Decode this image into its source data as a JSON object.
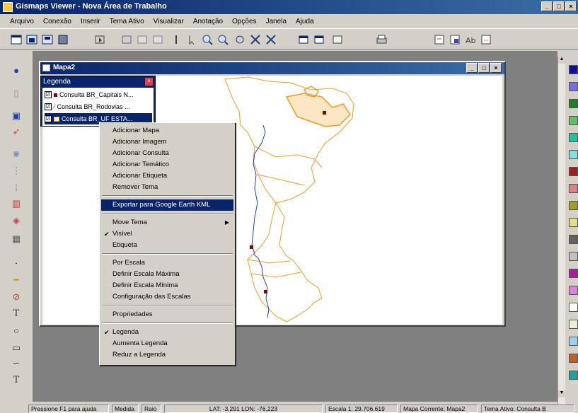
{
  "app": {
    "title": "Gismaps Viewer - Nova Área de Trabalho",
    "window_buttons": [
      "_",
      "□",
      "×"
    ]
  },
  "menu": [
    "Arquivo",
    "Conexão",
    "Inserir",
    "Tema Ativo",
    "Visualizar",
    "Anotação",
    "Opções",
    "Janela",
    "Ajuda"
  ],
  "toolbar": {
    "icons": [
      "new-map-icon",
      "open-icon",
      "save-icon",
      "view-icon",
      "select-icon",
      "info-icon",
      "pan-icon",
      "zoom-in-icon",
      "zoom-out-icon",
      "zoom-extent-icon",
      "measure-icon",
      "print-icon",
      "theme-icon",
      "label-icon",
      "help-icon"
    ]
  },
  "left_tools": [
    "globe-icon",
    "select-icon",
    "map-icon",
    "arrow-icon",
    "line-icon",
    "polygon-icon",
    "chart-icon",
    "layers-icon",
    "database-icon",
    "dot-icon",
    "line-tool-icon",
    "circle-tool-icon",
    "text-tool-icon",
    "ellipse-tool-icon",
    "rect-tool-icon",
    "curve-tool-icon",
    "text-big-icon"
  ],
  "map_window": {
    "title": "Mapa2",
    "buttons": [
      "_",
      "□",
      "×"
    ]
  },
  "legend": {
    "title": "Legenda",
    "items": [
      {
        "label": "Consulta BR_Capitais N...",
        "checked": "☑",
        "symbol_color": "#8b0000"
      },
      {
        "label": "Consulta BR_Rodovias ...",
        "checked": "☑",
        "symbol_color": "#1e3cd8"
      },
      {
        "label": "Consulta BR_UF ESTA...",
        "checked": "☑",
        "symbol_color": "#f59a23"
      }
    ]
  },
  "context_menu": {
    "groups": [
      [
        {
          "label": "Adicionar Mapa"
        },
        {
          "label": "Adicionar Imagem"
        },
        {
          "label": "Adicionar Consulta"
        },
        {
          "label": "Adicionar Temático"
        },
        {
          "label": "Adicionar Etiqueta"
        },
        {
          "label": "Remover Tema"
        }
      ],
      [
        {
          "label": "Exportar para Google Earth KML",
          "highlighted": true
        }
      ],
      [
        {
          "label": "Move Tema",
          "submenu": true
        },
        {
          "label": "Visível",
          "checked": true
        },
        {
          "label": "Etiqueta"
        }
      ],
      [
        {
          "label": "Por Escala"
        },
        {
          "label": "Definir Escala Máxima"
        },
        {
          "label": "Definir Escala Mínima"
        },
        {
          "label": "Configuração das Escalas"
        }
      ],
      [
        {
          "label": "Propriedades"
        }
      ],
      [
        {
          "label": "Legenda",
          "checked": true
        },
        {
          "label": "Aumenta Legenda"
        },
        {
          "label": "Reduz a Legenda"
        }
      ]
    ]
  },
  "palette_colors": [
    "#1010a0",
    "#7070e0",
    "#208020",
    "#60c060",
    "#20c0a0",
    "#80e0e0",
    "#a02020",
    "#e08080",
    "#a0a020",
    "#e0e080",
    "#606060",
    "#c0c0c0",
    "#a020a0",
    "#e080e0",
    "#ffffff",
    "#f0f0d0",
    "#a0d0f0",
    "#c06020",
    "#20a0a0"
  ],
  "status": {
    "help": "Pressione F1 para ajuda",
    "measure": "Medida",
    "radius": "Raio",
    "coords": "LAT: -3,291  LON: -76,223",
    "scale": "Escala 1: 29.706.619",
    "current_map": "Mapa Corrente: Mapa2",
    "active_theme": "Tema Ativo: Consulta B"
  },
  "colors": {
    "boundary": "#f59a23",
    "road": "#1e3cd8",
    "capital": "#8b0000"
  }
}
